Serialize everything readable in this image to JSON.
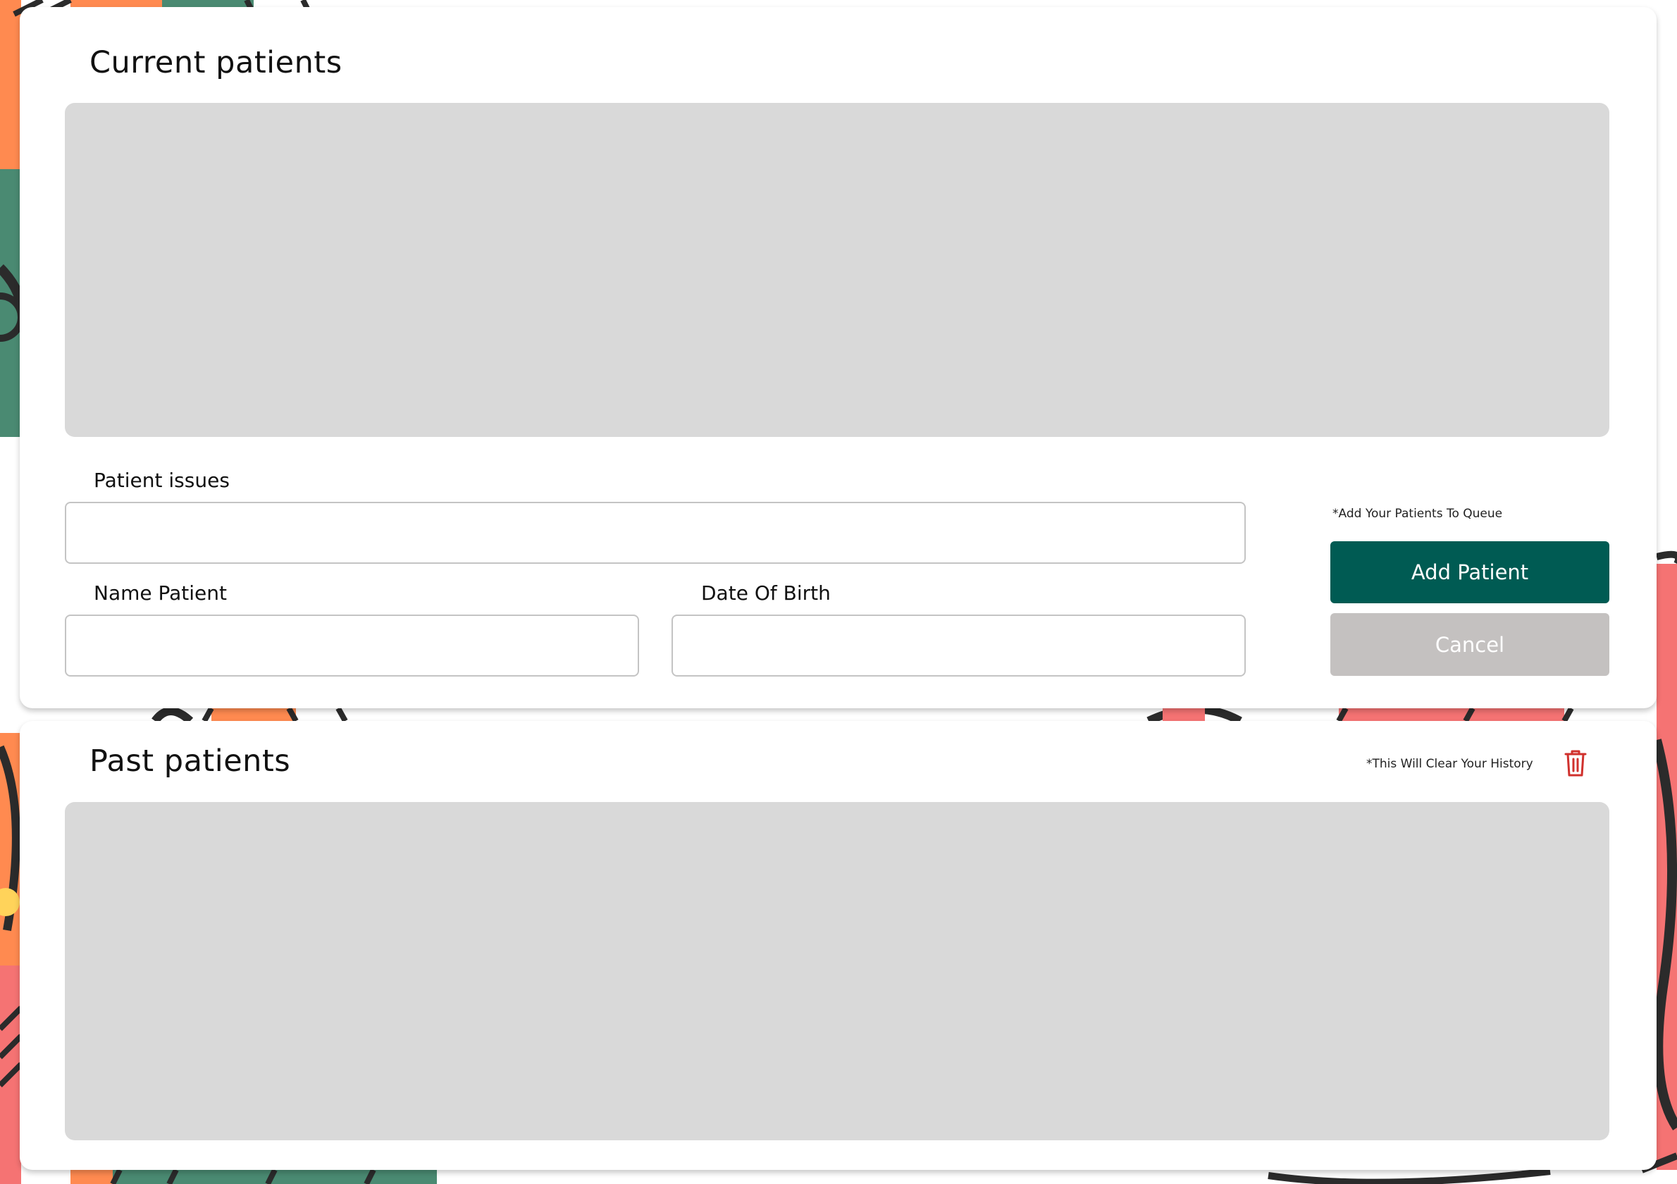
{
  "colors": {
    "primary": "#005b53",
    "cancel": "#c4c1c0",
    "list_bg": "#d9d9d9",
    "danger": "#d0312d",
    "bg_green": "#4a8a72",
    "bg_orange": "#ff8a50",
    "bg_red": "#f57373"
  },
  "current": {
    "title": "Current patients",
    "issues_label": "Patient issues",
    "issues_value": "",
    "name_label": "Name Patient",
    "name_value": "",
    "dob_label": "Date Of Birth",
    "dob_value": "",
    "queue_hint": "*Add Your Patients To Queue",
    "add_button": "Add Patient",
    "cancel_button": "Cancel"
  },
  "past": {
    "title": "Past patients",
    "clear_hint": "*This Will Clear Your History",
    "clear_icon": "trash-icon"
  }
}
